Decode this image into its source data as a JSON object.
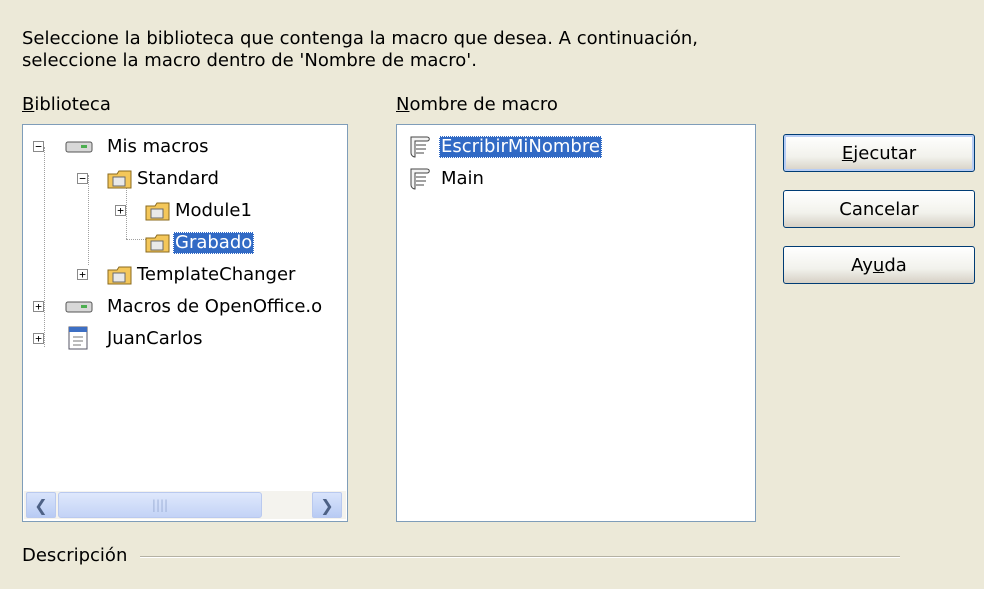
{
  "instructions": {
    "line1": "Seleccione la biblioteca que contenga la macro que desea. A continuación,",
    "line2": "seleccione la macro dentro de 'Nombre de macro'."
  },
  "library": {
    "label_first": "B",
    "label_rest": "iblioteca",
    "tree": [
      {
        "label": "Mis macros",
        "icon": "drive-icon",
        "level": 0,
        "expanded": true
      },
      {
        "label": "Standard",
        "icon": "folder-icon",
        "level": 1,
        "expanded": true
      },
      {
        "label": "Module1",
        "icon": "folder-icon",
        "level": 2,
        "expanded": false
      },
      {
        "label": "Grabado",
        "icon": "folder-icon",
        "level": 2,
        "selected": true
      },
      {
        "label": "TemplateChanger",
        "icon": "folder-icon",
        "level": 1,
        "expanded": false
      },
      {
        "label": "Macros de OpenOffice.o",
        "icon": "drive-icon",
        "level": 0,
        "expanded": false
      },
      {
        "label": "JuanCarlos",
        "icon": "document-icon",
        "level": 0,
        "expanded": false
      }
    ]
  },
  "macros": {
    "label_first": "N",
    "label_rest": "ombre de macro",
    "items": [
      {
        "label": "EscribirMiNombre",
        "selected": true
      },
      {
        "label": "Main",
        "selected": false
      }
    ]
  },
  "buttons": {
    "run": {
      "a": "E",
      "b": "jecutar"
    },
    "cancel": "Cancelar",
    "help": {
      "a": "Ay",
      "b": "u",
      "c": "da"
    }
  },
  "description_label": "Descripción"
}
